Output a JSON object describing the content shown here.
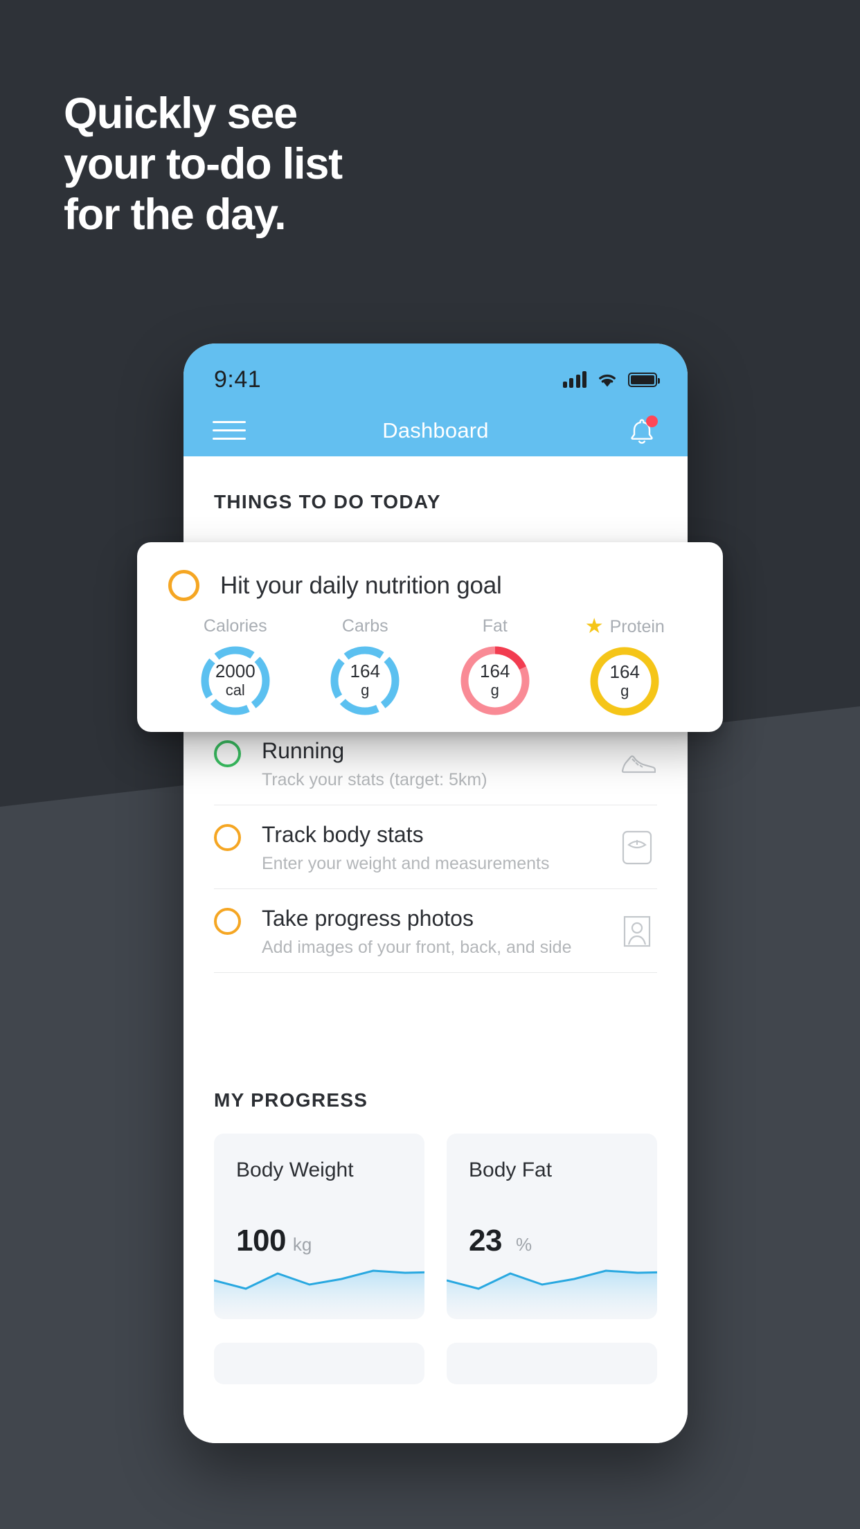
{
  "promo": {
    "headline": "Quickly see\nyour to-do list\nfor the day.",
    "bg_color": "#2e3238",
    "bg_wedge_color": "#41464d"
  },
  "phone": {
    "status_bar": {
      "clock": "9:41",
      "signal_icon": "signal-bars-icon",
      "wifi_icon": "wifi-icon",
      "battery_icon": "battery-full-icon"
    },
    "nav": {
      "menu_icon": "hamburger-menu-icon",
      "title": "Dashboard",
      "bell_icon": "notification-bell-icon",
      "bell_badge": true,
      "accent_color": "#63bff0"
    },
    "todo": {
      "section_title": "THINGS TO DO TODAY",
      "items": [
        {
          "title": "Running",
          "subtitle": "Track your stats (target: 5km)",
          "ring_color": "#3ac162",
          "icon": "running-shoe-icon"
        },
        {
          "title": "Track body stats",
          "subtitle": "Enter your weight and measurements",
          "ring_color": "#f5a623",
          "icon": "weight-scale-icon"
        },
        {
          "title": "Take progress photos",
          "subtitle": "Add images of your front, back, and side",
          "ring_color": "#f5a623",
          "icon": "photo-person-icon"
        }
      ]
    },
    "progress": {
      "section_title": "MY PROGRESS",
      "cards": [
        {
          "title": "Body Weight",
          "value": "100",
          "unit": "kg"
        },
        {
          "title": "Body Fat",
          "value": "23",
          "unit": "%"
        }
      ]
    }
  },
  "nutrition_card": {
    "ring_color": "#f5a623",
    "title": "Hit your daily nutrition goal",
    "macros": [
      {
        "label": "Calories",
        "value": "2000",
        "unit": "cal",
        "color": "#5bc0f0",
        "starred": false,
        "percent": 82
      },
      {
        "label": "Carbs",
        "value": "164",
        "unit": "g",
        "color": "#5bc0f0",
        "starred": false,
        "percent": 82
      },
      {
        "label": "Fat",
        "value": "164",
        "unit": "g",
        "color": "#f98a95",
        "starred": false,
        "percent": 100,
        "accent_color": "#f23c50",
        "accent_percent": 18
      },
      {
        "label": "Protein",
        "value": "164",
        "unit": "g",
        "color": "#f5c518",
        "starred": true,
        "percent": 100
      }
    ]
  }
}
